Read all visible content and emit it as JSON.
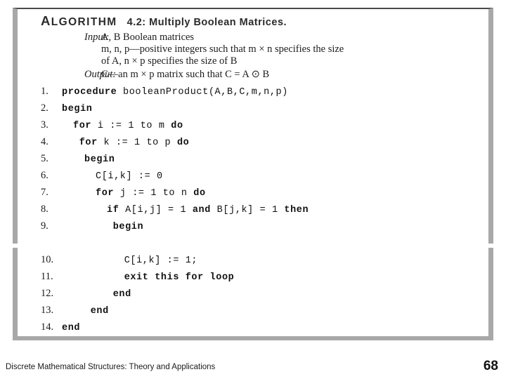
{
  "slide": {
    "algorithm": {
      "keyword": "ALGORITHM",
      "keyword_first_letter": "A",
      "keyword_rest": "LGORITHM",
      "title": "4.2: Multiply Boolean Matrices."
    },
    "io": {
      "input_label": "Input:",
      "input_lines": [
        "A, B Boolean matrices",
        "m, n, p—positive integers such that m × n specifies the size",
        "of A, n × p specifies the size of B"
      ],
      "output_label": "Output:",
      "output_lines": [
        "C—an m × p matrix such that C = A ⊙ B"
      ]
    },
    "code": [
      {
        "num": "1.",
        "indent": 0,
        "text": "procedure booleanProduct(A,B,C,m,n,p)"
      },
      {
        "num": "2.",
        "indent": 0,
        "text": "begin"
      },
      {
        "num": "3.",
        "indent": 1,
        "text": "for i := 1 to m do"
      },
      {
        "num": "4.",
        "indent": 1,
        "text": " for k := 1 to p do"
      },
      {
        "num": "5.",
        "indent": 2,
        "text": "begin"
      },
      {
        "num": "6.",
        "indent": 3,
        "text": "C[i,k] := 0"
      },
      {
        "num": "7.",
        "indent": 3,
        "text": "for j := 1 to n do"
      },
      {
        "num": "8.",
        "indent": 4,
        "text": "if A[i,j] = 1 and B[j,k] = 1 then"
      },
      {
        "num": "9.",
        "indent": 4,
        "text": " begin"
      },
      {
        "num": "10.",
        "indent": 5,
        "text": " C[i,k] := 1;"
      },
      {
        "num": "11.",
        "indent": 5,
        "text": " exit this for loop"
      },
      {
        "num": "12.",
        "indent": 4,
        "text": " end"
      },
      {
        "num": "13.",
        "indent": 2,
        "text": " end"
      },
      {
        "num": "14.",
        "indent": 0,
        "text": "end"
      }
    ],
    "footer": {
      "source": "Discrete Mathematical Structures: Theory and Applications",
      "page_number": "68"
    }
  }
}
